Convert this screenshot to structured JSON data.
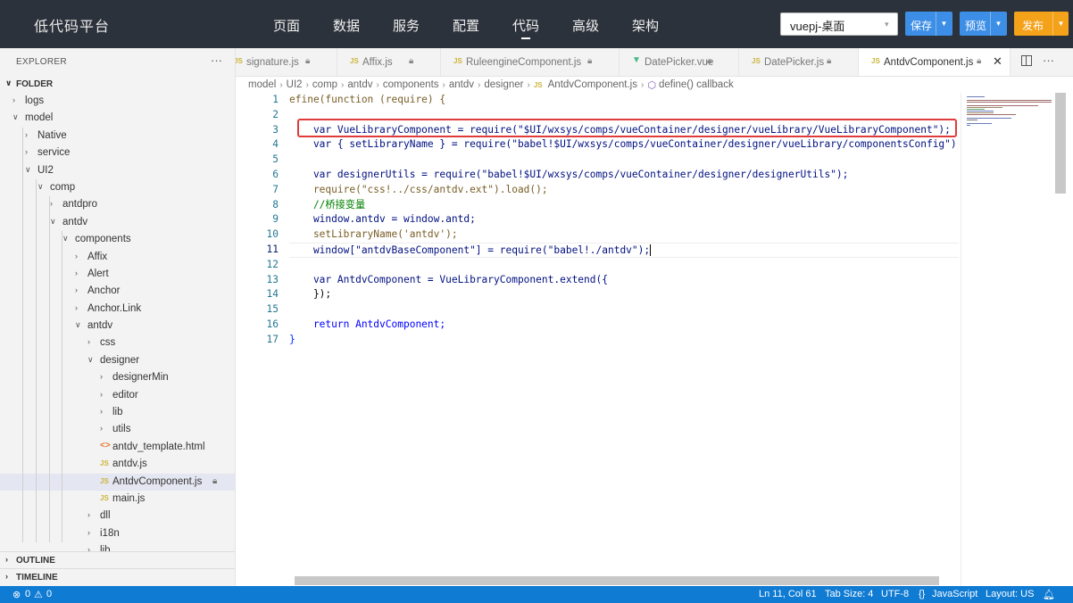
{
  "app": {
    "title": "低代码平台"
  },
  "nav": {
    "items": [
      "页面",
      "数据",
      "服务",
      "配置",
      "代码",
      "高级",
      "架构"
    ],
    "active": "代码"
  },
  "toolbar": {
    "project": "vuepj-桌面",
    "save_label": "保存",
    "preview_label": "预览",
    "publish_label": "发布",
    "colors": {
      "save": "#3d8ee6",
      "preview": "#3d8ee6",
      "publish": "#f5a21b"
    }
  },
  "explorer": {
    "title": "EXPLORER",
    "more": "···",
    "folder_label": "FOLDER",
    "tree": [
      {
        "label": "logs",
        "depth": 1,
        "kind": "folder",
        "open": false
      },
      {
        "label": "model",
        "depth": 1,
        "kind": "folder",
        "open": true
      },
      {
        "label": "Native",
        "depth": 2,
        "kind": "folder",
        "open": false
      },
      {
        "label": "service",
        "depth": 2,
        "kind": "folder",
        "open": false
      },
      {
        "label": "UI2",
        "depth": 2,
        "kind": "folder",
        "open": true
      },
      {
        "label": "comp",
        "depth": 3,
        "kind": "folder",
        "open": true
      },
      {
        "label": "antdpro",
        "depth": 4,
        "kind": "folder",
        "open": false
      },
      {
        "label": "antdv",
        "depth": 4,
        "kind": "folder",
        "open": true
      },
      {
        "label": "components",
        "depth": 5,
        "kind": "folder",
        "open": true
      },
      {
        "label": "Affix",
        "depth": 6,
        "kind": "folder",
        "open": false
      },
      {
        "label": "Alert",
        "depth": 6,
        "kind": "folder",
        "open": false
      },
      {
        "label": "Anchor",
        "depth": 6,
        "kind": "folder",
        "open": false
      },
      {
        "label": "Anchor.Link",
        "depth": 6,
        "kind": "folder",
        "open": false
      },
      {
        "label": "antdv",
        "depth": 6,
        "kind": "folder",
        "open": true
      },
      {
        "label": "css",
        "depth": 7,
        "kind": "folder",
        "open": false
      },
      {
        "label": "designer",
        "depth": 7,
        "kind": "folder",
        "open": true
      },
      {
        "label": "designerMin",
        "depth": 8,
        "kind": "folder",
        "open": false
      },
      {
        "label": "editor",
        "depth": 8,
        "kind": "folder",
        "open": false
      },
      {
        "label": "lib",
        "depth": 8,
        "kind": "folder",
        "open": false
      },
      {
        "label": "utils",
        "depth": 8,
        "kind": "folder",
        "open": false
      },
      {
        "label": "antdv_template.html",
        "depth": 8,
        "kind": "html"
      },
      {
        "label": "antdv.js",
        "depth": 8,
        "kind": "js"
      },
      {
        "label": "AntdvComponent.js",
        "depth": 8,
        "kind": "js",
        "selected": true,
        "locked": true
      },
      {
        "label": "main.js",
        "depth": 8,
        "kind": "js"
      },
      {
        "label": "dll",
        "depth": 7,
        "kind": "folder",
        "open": false
      },
      {
        "label": "i18n",
        "depth": 7,
        "kind": "folder",
        "open": false
      },
      {
        "label": "lib",
        "depth": 7,
        "kind": "folder",
        "open": false
      }
    ],
    "outline_label": "OUTLINE",
    "timeline_label": "TIMELINE"
  },
  "tabs": [
    {
      "label": "signature.js",
      "icon": "js",
      "locked": true
    },
    {
      "label": "Affix.js",
      "icon": "js",
      "locked": true
    },
    {
      "label": "RuleengineComponent.js",
      "icon": "js",
      "locked": true
    },
    {
      "label": "DatePicker.vue",
      "icon": "vue",
      "locked": true
    },
    {
      "label": "DatePicker.js",
      "icon": "js",
      "locked": true
    },
    {
      "label": "AntdvComponent.js",
      "icon": "js",
      "locked": true,
      "active": true
    }
  ],
  "breadcrumb": {
    "parts": [
      "model",
      "UI2",
      "comp",
      "antdv",
      "components",
      "antdv",
      "designer"
    ],
    "file": "AntdvComponent.js",
    "symbol": "define() callback"
  },
  "editor": {
    "line_numbers": [
      "1",
      "2",
      "3",
      "4",
      "5",
      "6",
      "7",
      "8",
      "9",
      "10",
      "11",
      "12",
      "13",
      "14",
      "15",
      "16",
      "17"
    ],
    "current_line": 11,
    "lines": {
      "l1": "efine(function (require) {",
      "l3": "    var VueLibraryComponent = require(\"$UI/wxsys/comps/vueContainer/designer/vueLibrary/VueLibraryComponent\");",
      "l4": "    var { setLibraryName } = require(\"babel!$UI/wxsys/comps/vueContainer/designer/vueLibrary/componentsConfig\");",
      "l6": "    var designerUtils = require(\"babel!$UI/wxsys/comps/vueContainer/designer/designerUtils\");",
      "l7": "    require(\"css!../css/antdv.ext\").load();",
      "l8": "    //桥接变量",
      "l9": "    window.antdv = window.antd;",
      "l10": "    setLibraryName('antdv');",
      "l11": "    window[\"antdvBaseComponent\"] = require(\"babel!./antdv\");",
      "l13": "    var AntdvComponent = VueLibraryComponent.extend({",
      "l14": "    });",
      "l16": "    return AntdvComponent;",
      "l17": "}"
    }
  },
  "status": {
    "errors": "0",
    "warnings": "0",
    "position": "Ln 11, Col 61",
    "tab_size": "Tab Size: 4",
    "encoding": "UTF-8",
    "language": "JavaScript",
    "layout": "Layout: US",
    "color": "#0f7bd3"
  }
}
